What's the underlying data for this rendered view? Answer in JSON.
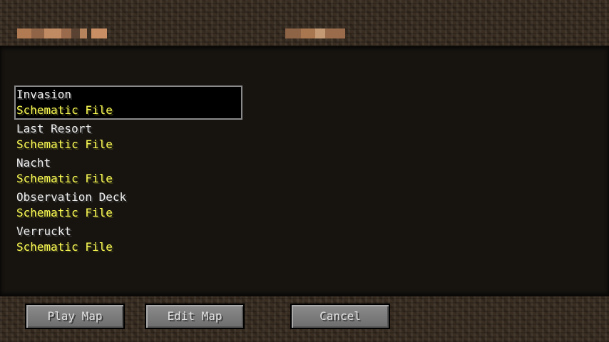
{
  "maps": [
    {
      "name": "Invasion",
      "type": "Schematic File",
      "selected": true
    },
    {
      "name": "Last Resort",
      "type": "Schematic File",
      "selected": false
    },
    {
      "name": "Nacht",
      "type": "Schematic File",
      "selected": false
    },
    {
      "name": "Observation Deck",
      "type": "Schematic File",
      "selected": false
    },
    {
      "name": "Verruckt",
      "type": "Schematic File",
      "selected": false
    }
  ],
  "buttons": {
    "play": "Play Map",
    "edit": "Edit Map",
    "cancel": "Cancel"
  },
  "colors": {
    "item_name": "#f0f0f0",
    "item_type": "#ffff55",
    "button_text": "#e0e0e0",
    "panel": "#171410"
  }
}
